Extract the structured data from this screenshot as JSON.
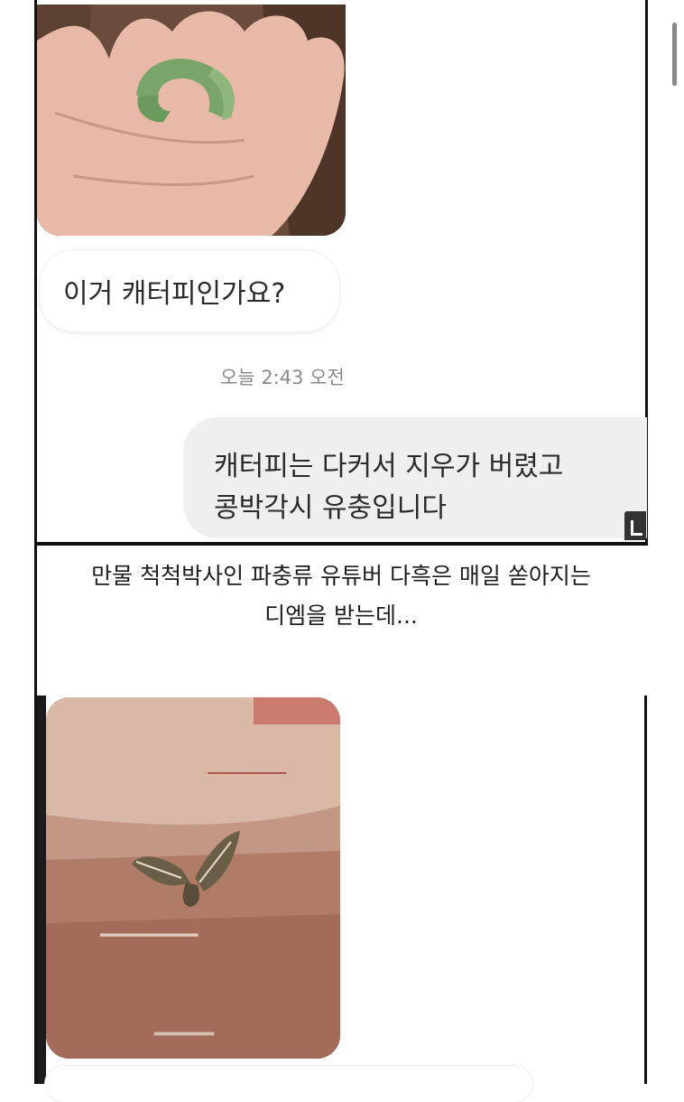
{
  "chat_top": {
    "incoming_message": "이거 캐터피인가요?",
    "timestamp": "오늘 2:43 오전",
    "reply_line1": "캐터피는 다커서 지우가 버렸고",
    "reply_line2": "콩박각시 유충입니다"
  },
  "caption": {
    "line1": "만물 척척박사인 파충류 유튜버 다흑은 매일 쏟아지는",
    "line2": "디엠을 받는데..."
  },
  "images": {
    "photo1_icon": "caterpillar-on-hand-photo",
    "photo2_icon": "moth-on-sign-photo"
  },
  "colors": {
    "outgoing_bubble": "#efefef",
    "timestamp": "#8a8a8a",
    "frame": "#111111"
  }
}
